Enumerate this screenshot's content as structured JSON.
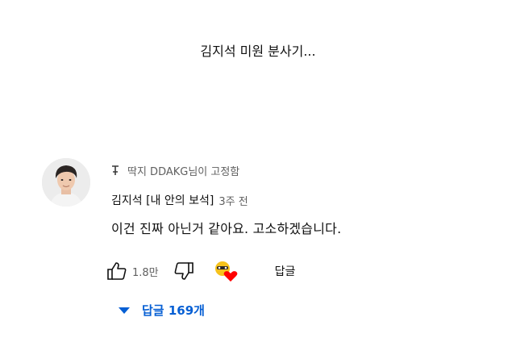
{
  "video": {
    "caption": "김지석 미원 분사기..."
  },
  "comment": {
    "pinned_text": "딱지 DDAKG님이 고정함",
    "author": "김지석 [내 안의 보석]",
    "time": "3주 전",
    "text": "이건 진짜 아닌거 같아요. 고소하겠습니다.",
    "like_count": "1.8만",
    "reply_label": "답글",
    "replies_toggle_label": "답글 169개"
  },
  "colors": {
    "link_blue": "#065fd4",
    "heart_red": "#ff0000",
    "badge_yellow": "#f6c21c"
  },
  "icons": {
    "pin": "pin-icon",
    "like": "thumb-up-icon",
    "dislike": "thumb-down-icon",
    "creator_heart": "creator-heart-icon",
    "expand": "chevron-down-icon"
  }
}
